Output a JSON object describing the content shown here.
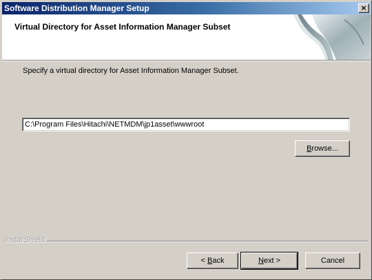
{
  "window": {
    "title": "Software Distribution Manager Setup",
    "close_glyph": "×"
  },
  "header": {
    "title": "Virtual Directory for Asset Information Manager Subset",
    "graphic_icon": "page-curl-graphic"
  },
  "body": {
    "prompt": "Specify a virtual directory for Asset Information Manager Subset.",
    "path_value": "C:\\Program Files\\Hitachi\\NETMDM\\jp1asset\\wwwroot",
    "browse": {
      "mnemonic": "B",
      "rest": "rowse..."
    }
  },
  "footer": {
    "brand": "InstallShield",
    "back": {
      "prefix": "< ",
      "mnemonic": "B",
      "rest": "ack"
    },
    "next": {
      "mnemonic": "N",
      "rest": "ext >"
    },
    "cancel": "Cancel"
  },
  "colors": {
    "title_gradient_start": "#0a246a",
    "title_gradient_end": "#a6caf0",
    "face": "#d4d0c8"
  }
}
